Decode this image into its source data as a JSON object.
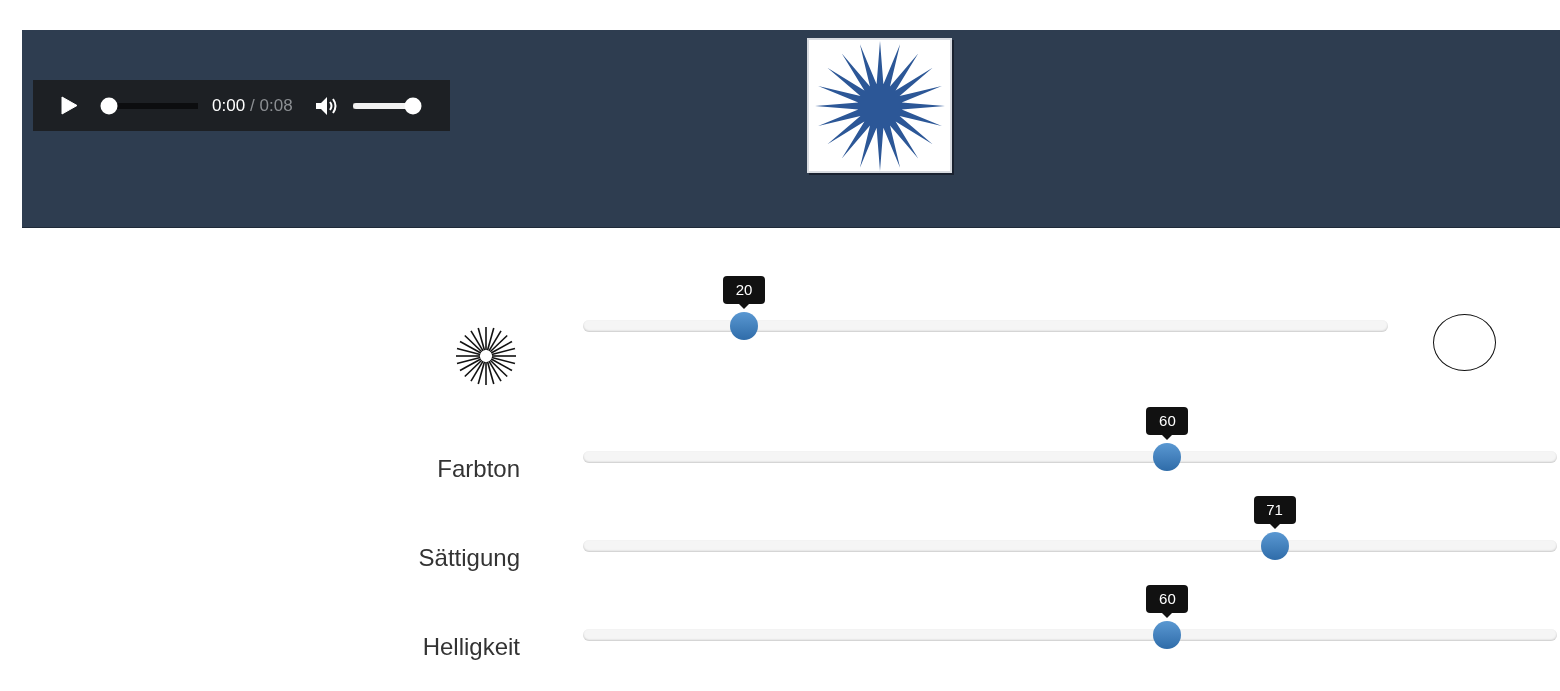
{
  "audio_player": {
    "playing": false,
    "elapsed": "0:00",
    "duration": "/ 0:08",
    "progress": {
      "level": 0
    },
    "volume": {
      "level": 1
    }
  },
  "sliders": [
    {
      "kind": "icon",
      "value": "20",
      "level": 0.2
    },
    {
      "kind": "label",
      "label": "Farbton",
      "value": "60",
      "level": 0.6
    },
    {
      "kind": "label",
      "label": "Sättigung",
      "value": "71",
      "level": 0.71
    },
    {
      "kind": "label",
      "label": "Helligkeit",
      "value": "60",
      "level": 0.6
    }
  ]
}
